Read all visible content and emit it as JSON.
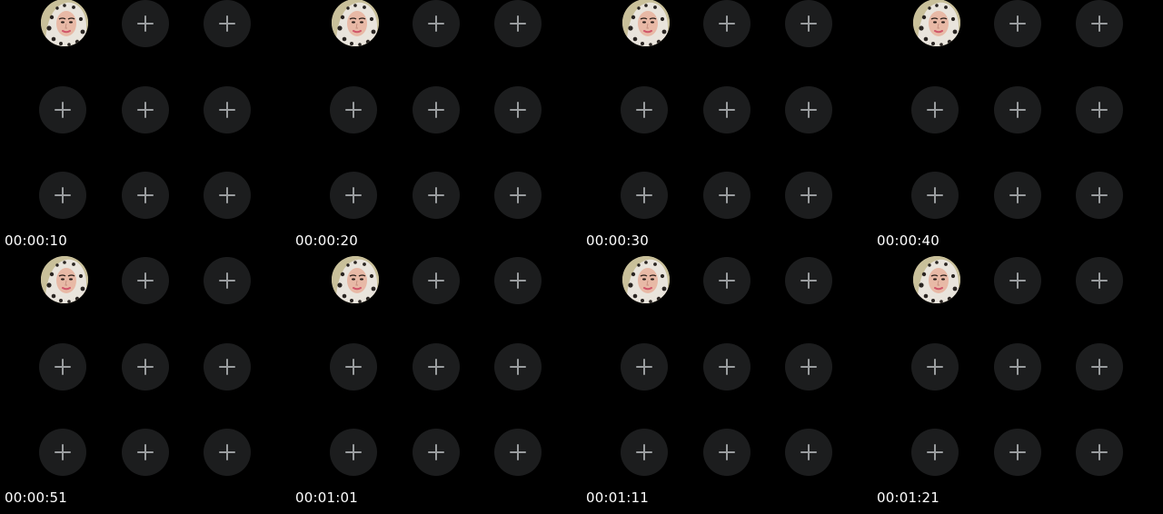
{
  "colors": {
    "background": "#000000",
    "slot": "#1c1d1e",
    "plus": "#9a9d9f",
    "timestamp": "#ffffff"
  },
  "slot_icon": "plus-icon",
  "frames": [
    {
      "timestamp": "00:00:10"
    },
    {
      "timestamp": "00:00:20"
    },
    {
      "timestamp": "00:00:30"
    },
    {
      "timestamp": "00:00:40"
    },
    {
      "timestamp": "00:00:51"
    },
    {
      "timestamp": "00:01:01"
    },
    {
      "timestamp": "00:01:11"
    },
    {
      "timestamp": "00:01:21"
    }
  ]
}
